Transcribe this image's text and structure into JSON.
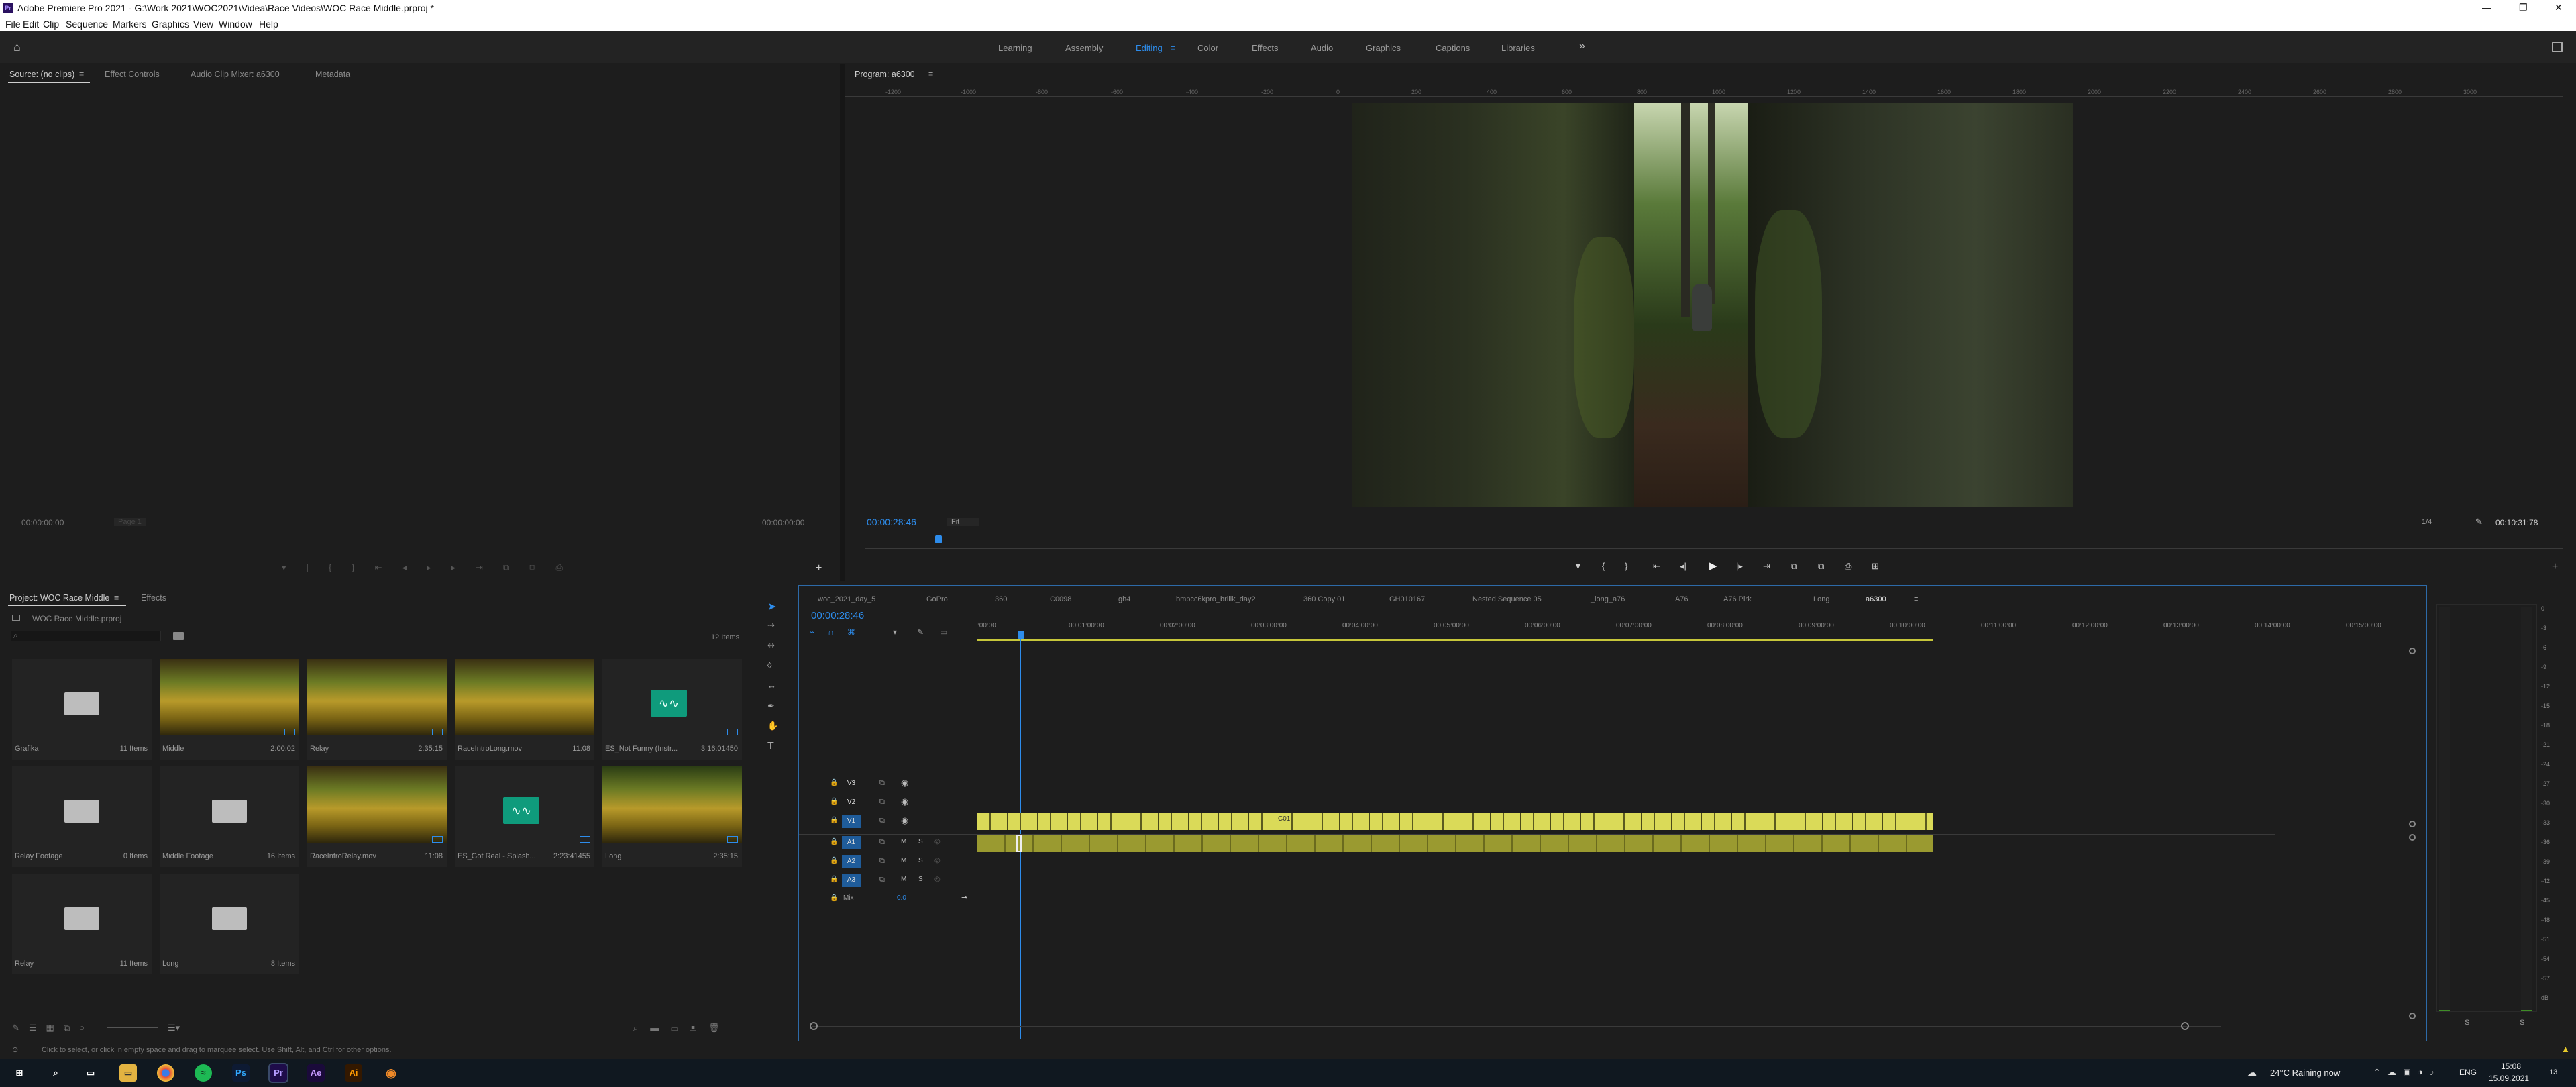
{
  "titlebar": {
    "title": "Adobe Premiere Pro 2021 - G:\\Work 2021\\WOC2021\\Videa\\Race Videos\\WOC Race Middle.prproj *",
    "min": "—",
    "max": "❐",
    "close": "✕"
  },
  "menu": [
    "File",
    "Edit",
    "Clip",
    "Sequence",
    "Markers",
    "Graphics",
    "View",
    "Window",
    "Help"
  ],
  "workspaces": {
    "items": [
      "Learning",
      "Assembly",
      "Editing",
      "Color",
      "Effects",
      "Audio",
      "Graphics",
      "Captions",
      "Libraries"
    ],
    "active": "Editing",
    "more": "»"
  },
  "source_panel": {
    "tabs": [
      "Source: (no clips)",
      "Effect Controls",
      "Audio Clip Mixer: a6300",
      "Metadata"
    ],
    "tc_left": "00:00:00:00",
    "tc_right": "00:00:00:00",
    "page": "Page 1"
  },
  "program_panel": {
    "tab": "Program: a6300",
    "timecode": "00:00:28:46",
    "fit": "Fit",
    "quality": "1/4",
    "duration": "00:10:31:78",
    "ruler_labels": [
      "-1200",
      "-1000",
      "-800",
      "-600",
      "-400",
      "-200",
      "0",
      "200",
      "400",
      "600",
      "800",
      "1000",
      "1200",
      "1400",
      "1600",
      "1800",
      "2000",
      "2200",
      "2400",
      "2600",
      "2800",
      "3000"
    ]
  },
  "project_panel": {
    "tabs": [
      "Project: WOC Race Middle",
      "Effects"
    ],
    "file": "WOC Race Middle.prproj",
    "count": "12 Items",
    "items": [
      {
        "name": "Grafika",
        "info": "11 Items",
        "kind": "folder"
      },
      {
        "name": "Middle",
        "info": "2:00:02",
        "kind": "video"
      },
      {
        "name": "Relay",
        "info": "2:35:15",
        "kind": "video"
      },
      {
        "name": "RaceIntroLong.mov",
        "info": "11:08",
        "kind": "video"
      },
      {
        "name": "ES_Not Funny (Instr...",
        "info": "3:16:01450",
        "kind": "audio"
      },
      {
        "name": "Relay Footage",
        "info": "0 Items",
        "kind": "folder"
      },
      {
        "name": "Middle Footage",
        "info": "16 Items",
        "kind": "folder"
      },
      {
        "name": "RaceIntroRelay.mov",
        "info": "11:08",
        "kind": "video"
      },
      {
        "name": "ES_Got Real - Splash...",
        "info": "2:23:41455",
        "kind": "audio"
      },
      {
        "name": "Long",
        "info": "2:35:15",
        "kind": "video"
      },
      {
        "name": "Relay",
        "info": "11 Items",
        "kind": "folder"
      },
      {
        "name": "Long",
        "info": "8 Items",
        "kind": "folder"
      }
    ]
  },
  "timeline": {
    "tabs": [
      "woc_2021_day_5",
      "GoPro",
      "360",
      "C0098",
      "gh4",
      "bmpcc6kpro_brilik_day2",
      "360 Copy 01",
      "GH010167",
      "Nested Sequence 05",
      "_long_a76",
      "A76",
      "A76 Pirk",
      "Long",
      "a6300"
    ],
    "active_tab": "a6300",
    "timecode": "00:00:28:46",
    "ruler": [
      ":00:00",
      "00:01:00:00",
      "00:02:00:00",
      "00:03:00:00",
      "00:04:00:00",
      "00:05:00:00",
      "00:06:00:00",
      "00:07:00:00",
      "00:08:00:00",
      "00:09:00:00",
      "00:10:00:00",
      "00:11:00:00",
      "00:12:00:00",
      "00:13:00:00",
      "00:14:00:00",
      "00:15:00:00"
    ],
    "tracks": [
      {
        "id": "V3",
        "type": "video"
      },
      {
        "id": "V2",
        "type": "video"
      },
      {
        "id": "V1",
        "type": "video"
      },
      {
        "id": "A1",
        "type": "audio"
      },
      {
        "id": "A2",
        "type": "audio"
      },
      {
        "id": "A3",
        "type": "audio"
      }
    ],
    "mix_label": "Mix",
    "mix_value": "0.0",
    "clip_marker": "C01",
    "track_btn_m": "M",
    "track_btn_s": "S"
  },
  "meter": {
    "scale": [
      "0",
      "-3",
      "-6",
      "-9",
      "-12",
      "-15",
      "-18",
      "-21",
      "-24",
      "-27",
      "-30",
      "-33",
      "-36",
      "-39",
      "-42",
      "-45",
      "-48",
      "-51",
      "-54",
      "-57",
      "dB"
    ],
    "bottom_l": "S",
    "bottom_r": "S"
  },
  "status": {
    "text": "Click to select, or click in empty space and drag to marquee select. Use Shift, Alt, and Ctrl for other options."
  },
  "taskbar": {
    "weather": "24°C  Raining now",
    "lang": "ENG",
    "time": "15:08",
    "date": "15.09.2021",
    "apps": [
      "Ps",
      "Pr",
      "Ae",
      "Ai"
    ],
    "notif": "13"
  }
}
